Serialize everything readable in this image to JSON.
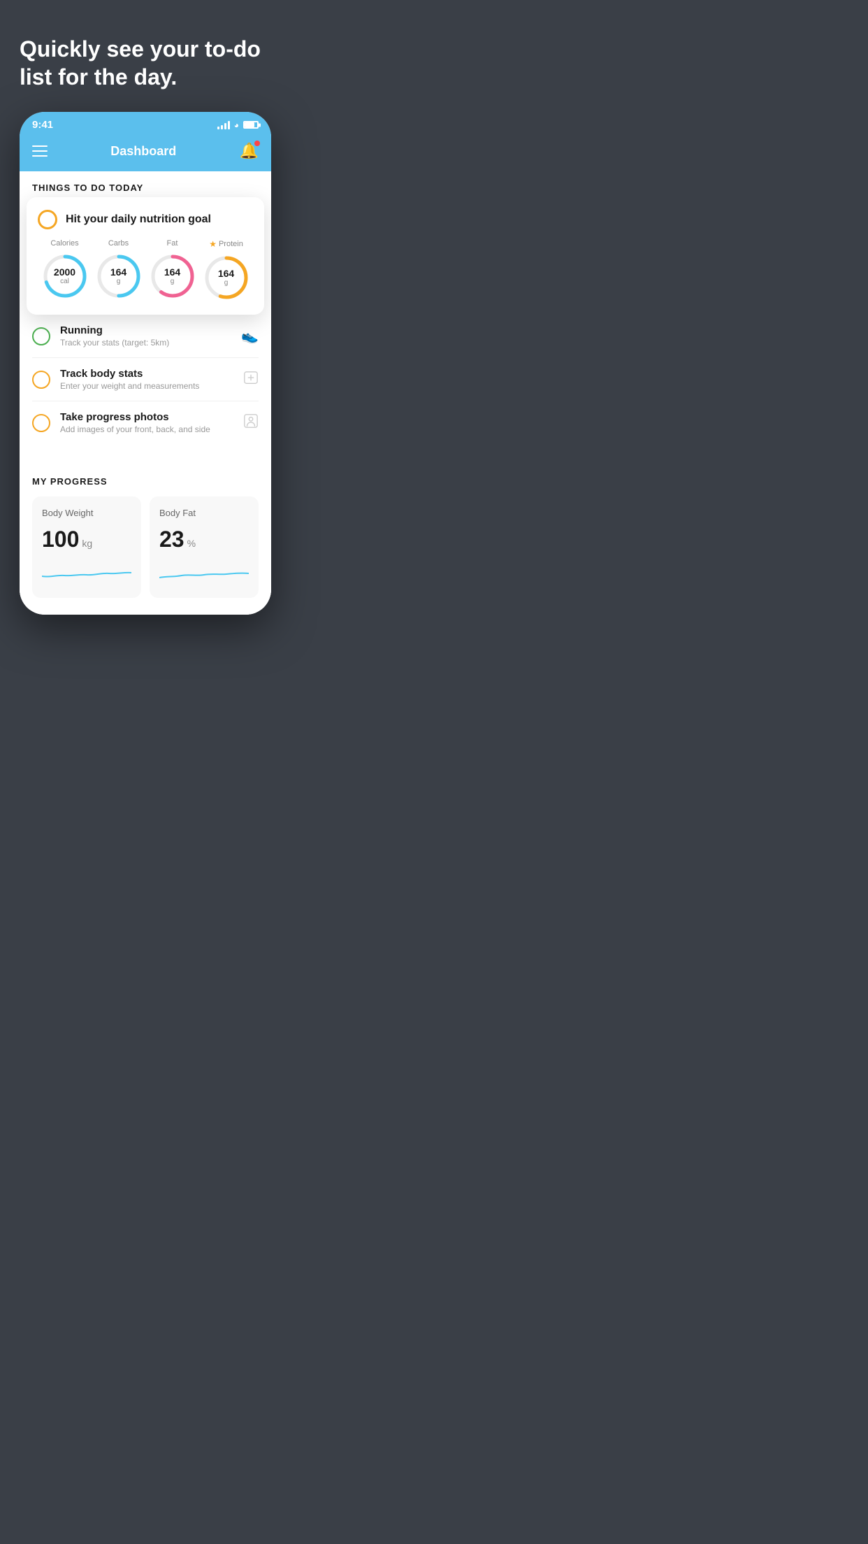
{
  "page": {
    "background_color": "#3a3f47"
  },
  "hero": {
    "text": "Quickly see your to-do list for the day."
  },
  "status_bar": {
    "time": "9:41",
    "signal_strength": 4,
    "battery_percent": 80
  },
  "header": {
    "title": "Dashboard",
    "menu_label": "menu",
    "bell_label": "notifications",
    "has_notification": true
  },
  "things_header": {
    "label": "THINGS TO DO TODAY"
  },
  "floating_card": {
    "title": "Hit your daily nutrition goal",
    "nutrition": [
      {
        "label": "Calories",
        "value": "2000",
        "unit": "cal",
        "color": "#4ac8f0",
        "star": false,
        "progress": 0.7
      },
      {
        "label": "Carbs",
        "value": "164",
        "unit": "g",
        "color": "#4ac8f0",
        "star": false,
        "progress": 0.5
      },
      {
        "label": "Fat",
        "value": "164",
        "unit": "g",
        "color": "#f06292",
        "star": false,
        "progress": 0.6
      },
      {
        "label": "Protein",
        "value": "164",
        "unit": "g",
        "color": "#f5a623",
        "star": true,
        "progress": 0.55
      }
    ]
  },
  "todo_items": [
    {
      "title": "Running",
      "subtitle": "Track your stats (target: 5km)",
      "circle_color": "green",
      "icon": "shoe"
    },
    {
      "title": "Track body stats",
      "subtitle": "Enter your weight and measurements",
      "circle_color": "yellow",
      "icon": "scale"
    },
    {
      "title": "Take progress photos",
      "subtitle": "Add images of your front, back, and side",
      "circle_color": "yellow",
      "icon": "person"
    }
  ],
  "my_progress": {
    "header": "MY PROGRESS",
    "cards": [
      {
        "title": "Body Weight",
        "value": "100",
        "unit": "kg"
      },
      {
        "title": "Body Fat",
        "value": "23",
        "unit": "%"
      }
    ]
  }
}
